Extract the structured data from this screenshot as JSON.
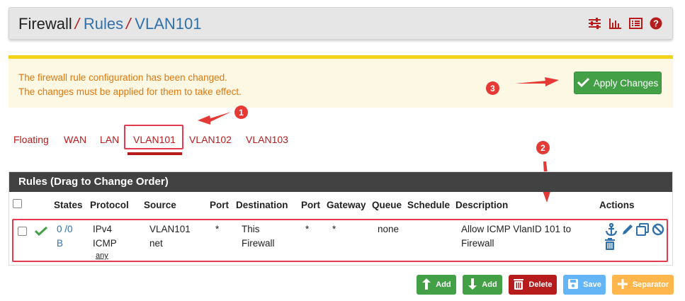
{
  "breadcrumb": {
    "root": "Firewall",
    "separator": "/",
    "rules": "Rules",
    "vlan": "VLAN101"
  },
  "header_icons": [
    "sliders-icon",
    "bar-chart-icon",
    "list-icon",
    "help-icon"
  ],
  "alert": {
    "line1": "The firewall rule configuration has been changed.",
    "line2": "The changes must be applied for them to take effect.",
    "apply_label": "Apply Changes"
  },
  "annotations": {
    "badge1": "1",
    "badge2": "2",
    "badge3": "3"
  },
  "tabs": [
    "Floating",
    "WAN",
    "LAN",
    "VLAN101",
    "VLAN102",
    "VLAN103"
  ],
  "active_tab": "VLAN101",
  "panel": {
    "title": "Rules (Drag to Change Order)",
    "columns": [
      "States",
      "Protocol",
      "Source",
      "Port",
      "Destination",
      "Port",
      "Gateway",
      "Queue",
      "Schedule",
      "Description",
      "Actions"
    ]
  },
  "rule": {
    "states_1": "0 /0",
    "states_2": "B",
    "protocol_1": "IPv4",
    "protocol_2": "ICMP",
    "protocol_3": "any",
    "source_1": "VLAN101",
    "source_2": "net",
    "port": "*",
    "destination_1": "This",
    "destination_2": "Firewall",
    "dest_port": "*",
    "gateway": "*",
    "queue": "none",
    "schedule": "",
    "description_1": "Allow ICMP VlanID 101 to",
    "description_2": "Firewall"
  },
  "buttons": {
    "add_top": "Add",
    "add_bottom": "Add",
    "delete": "Delete",
    "save": "Save",
    "separator": "Separator"
  },
  "colors": {
    "brand_red": "#b71c1c",
    "link_blue": "#3071a9",
    "success_green": "#43a047",
    "annotation_red": "#e53935",
    "alert_text": "#e0770f",
    "save_blue": "#64b5f6",
    "separator_orange": "#ffb74d"
  }
}
